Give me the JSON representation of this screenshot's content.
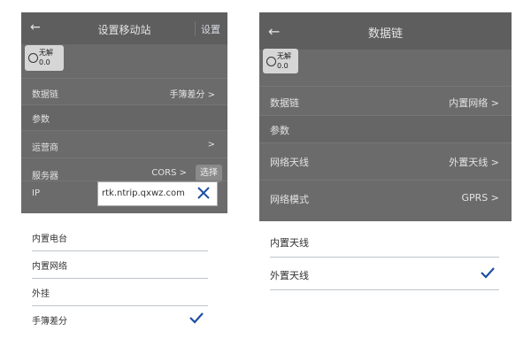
{
  "left": {
    "title": "设置移动站",
    "action": "设置",
    "status": {
      "label": "无解",
      "value": "0.0"
    },
    "rows": [
      {
        "label": "数据链",
        "value": "手簿差分 >"
      },
      {
        "label": "参数",
        "value": ""
      },
      {
        "label": "运营商",
        "value": ">"
      },
      {
        "label": "服务器",
        "value": "CORS >",
        "button": "选择"
      },
      {
        "label": "IP",
        "value": "rtk.ntrip.qxwz.com"
      }
    ],
    "options": [
      "内置电台",
      "内置网络",
      "外挂",
      "手簿差分"
    ],
    "selected_index": 3
  },
  "right": {
    "title": "数据链",
    "status": {
      "label": "无解",
      "value": "0.0"
    },
    "rows": [
      {
        "label": "数据链",
        "value": "内置网络 >"
      },
      {
        "label": "参数",
        "value": ""
      },
      {
        "label": "网络天线",
        "value": "外置天线 >"
      },
      {
        "label": "网络模式",
        "value": "GPRS >"
      }
    ],
    "options": [
      "内置天线",
      "外置天线"
    ],
    "selected_index": 1
  },
  "colors": {
    "accent": "#1e4fa3",
    "overlay": "#6b6b6b"
  },
  "icons": {
    "back": "arrow-left-icon",
    "clear": "close-icon",
    "check": "checkmark-icon"
  }
}
